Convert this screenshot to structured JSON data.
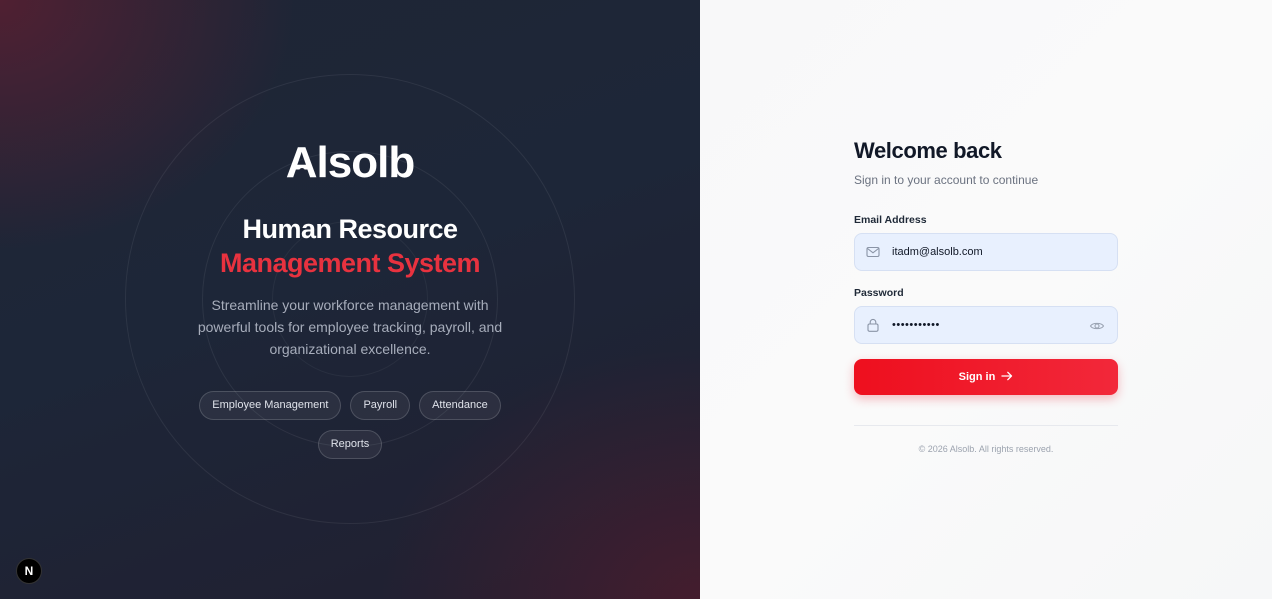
{
  "brand": {
    "logo_text": "Alsolb",
    "headline_line1": "Human Resource",
    "headline_line2": "Management System",
    "tagline": "Streamline your workforce management with powerful tools for employee tracking, payroll, and organizational excellence.",
    "features": [
      "Employee Management",
      "Payroll",
      "Attendance",
      "Reports"
    ],
    "accent_color": "#e8323f"
  },
  "dev_badge": {
    "letter": "N"
  },
  "form": {
    "title": "Welcome back",
    "subtitle": "Sign in to your account to continue",
    "email_label": "Email Address",
    "email_value": "itadm@alsolb.com",
    "password_label": "Password",
    "password_value": "•••••••••••",
    "signin_label": "Sign in",
    "button_color": "#ee0f1e"
  },
  "footer": {
    "copyright": "© 2026 Alsolb. All rights reserved."
  },
  "icons": {
    "email": "mail-icon",
    "password": "lock-icon",
    "toggle": "eye-icon",
    "submit": "arrow-right-icon"
  }
}
